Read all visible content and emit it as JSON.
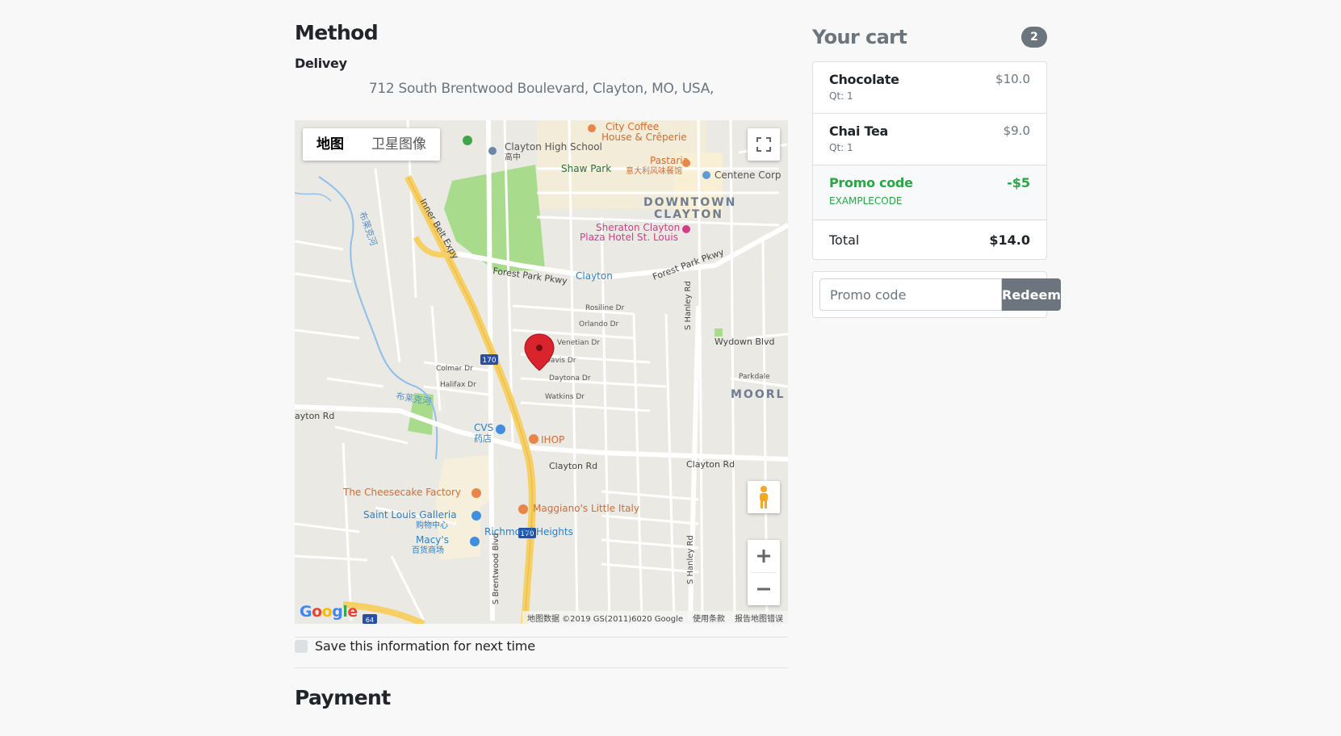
{
  "method": {
    "title": "Method",
    "delivery_label": "Delivey",
    "address": "712 South Brentwood Boulevard, Clayton, MO, USA,"
  },
  "map": {
    "type_buttons": [
      "地图",
      "卫星图像"
    ],
    "active_type": "地图",
    "labels": {
      "clayton_high": "Clayton High School",
      "gaozhong": "高中",
      "shaw_park": "Shaw Park",
      "pastaria": "Pastaria",
      "pastaria_cn": "意大利风味餐馆",
      "centene": "Centene Corp",
      "city_coffee": "City Coffee",
      "creperie": "House & Crêperie",
      "downtown": "DOWNTOWN",
      "clayton_big": "CLAYTON",
      "sheraton1": "Sheraton Clayton",
      "sheraton2": "Plaza Hotel St. Louis",
      "inner_belt": "Inner Belt Expy",
      "forest_park1": "Forest Park Pkwy",
      "forest_park2": "Forest Park Pkwy",
      "clayton_station": "Clayton",
      "rosiline": "Rosiline Dr",
      "orlando": "Orlando Dr",
      "venetian": "Venetian Dr",
      "davis": "Davis Dr",
      "daytona": "Daytona Dr",
      "watkins": "Watkins Dr",
      "colmar": "Colmar Dr",
      "halifax": "Halifax Dr",
      "wydown": "Wydown Blvd",
      "moorl": "MOORL",
      "parkdale": "Parkdale",
      "clayton_rd1": "Clayton Rd",
      "clayton_rd2": "Clayton Rd",
      "clayton_rd3": "ayton Rd",
      "cvs": "CVS",
      "cvs_cn": "药店",
      "ihop": "IHOP",
      "cheesecake": "The Cheesecake Factory",
      "galleria1": "Saint Louis Galleria",
      "galleria2": "购物中心",
      "macys1": "Macy's",
      "macys2": "百货商场",
      "maggianos": "Maggiano's Little Italy",
      "richmond": "Richmond Heights",
      "river1": "布莱克河",
      "river2": "布莱克河",
      "s_hanley1": "S Hanley Rd",
      "s_hanley2": "S Hanley Rd",
      "s_brentwood": "S Brentwood Blvd",
      "i170a": "170",
      "i170b": "170",
      "i64": "64"
    },
    "google": "Google",
    "attribution": [
      "地图数据 ©2019 GS(2011)6020 Google",
      "使用条款",
      "报告地图错误"
    ]
  },
  "save_info": "Save this information for next time",
  "payment_title": "Payment",
  "cart": {
    "title": "Your cart",
    "count": "2",
    "items": [
      {
        "name": "Chocolate",
        "qty": "Qt: 1",
        "price": "$10.0"
      },
      {
        "name": "Chai Tea",
        "qty": "Qt: 1",
        "price": "$9.0"
      }
    ],
    "promo": {
      "label": "Promo code",
      "code": "EXAMPLECODE",
      "amount": "-$5"
    },
    "total": {
      "label": "Total",
      "value": "$14.0"
    }
  },
  "promo_form": {
    "placeholder": "Promo code",
    "button": "Redeem"
  },
  "colors": {
    "accent": "#6c757d",
    "promo_green": "#28a745",
    "park": "#a8dc8c",
    "highway": "#f6cf65",
    "pin": "#d9232d"
  }
}
